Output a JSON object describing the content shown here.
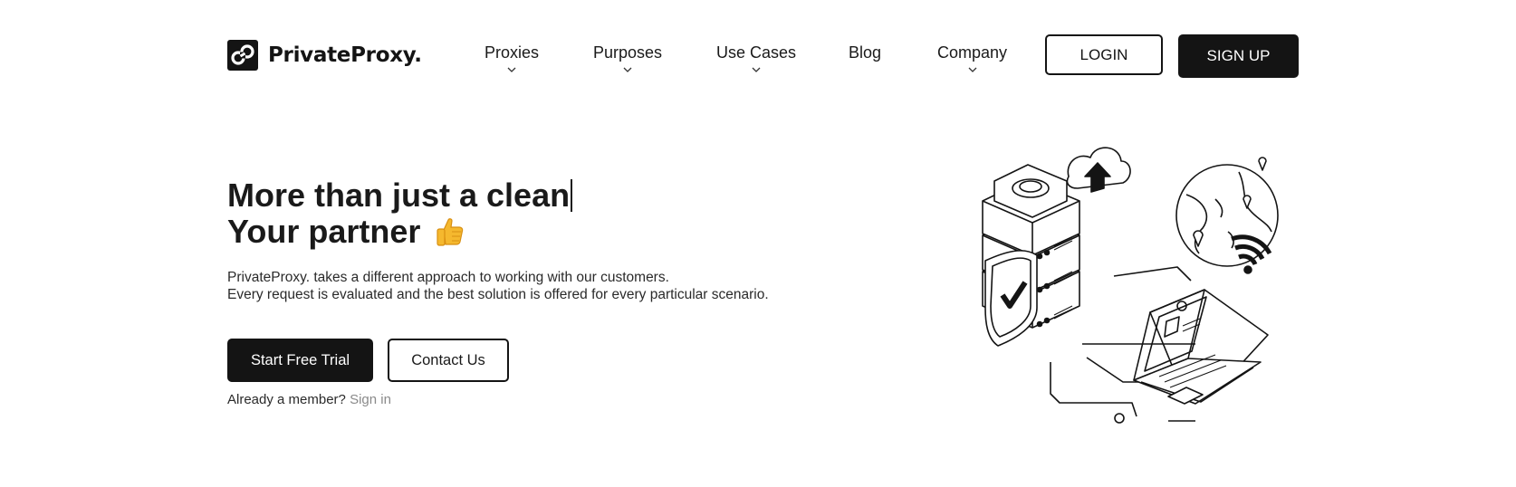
{
  "brand": {
    "name": "PrivateProxy.",
    "logo_icon": "privateproxy-logo-icon"
  },
  "nav": {
    "items": [
      {
        "label": "Proxies",
        "has_dropdown": true
      },
      {
        "label": "Purposes",
        "has_dropdown": true
      },
      {
        "label": "Use Cases",
        "has_dropdown": true
      },
      {
        "label": "Blog",
        "has_dropdown": false
      },
      {
        "label": "Company",
        "has_dropdown": true
      }
    ],
    "login_label": "LOGIN",
    "signup_label": "SIGN UP"
  },
  "hero": {
    "title_line1": "More than just a clean",
    "title_line2": "Your partner",
    "title_emoji": "thumbs-up-icon",
    "desc_line1": "PrivateProxy. takes a different approach to working with our customers.",
    "desc_line2": "Every request is evaluated and the best solution is offered for every particular scenario.",
    "primary_cta": "Start Free Trial",
    "secondary_cta": "Contact Us",
    "member_text": "Already a member?",
    "signin_link": "Sign in",
    "illustration": "server-network-illustration"
  },
  "colors": {
    "primary": "#141414",
    "background": "#ffffff",
    "link_muted": "#8a8a8a"
  }
}
